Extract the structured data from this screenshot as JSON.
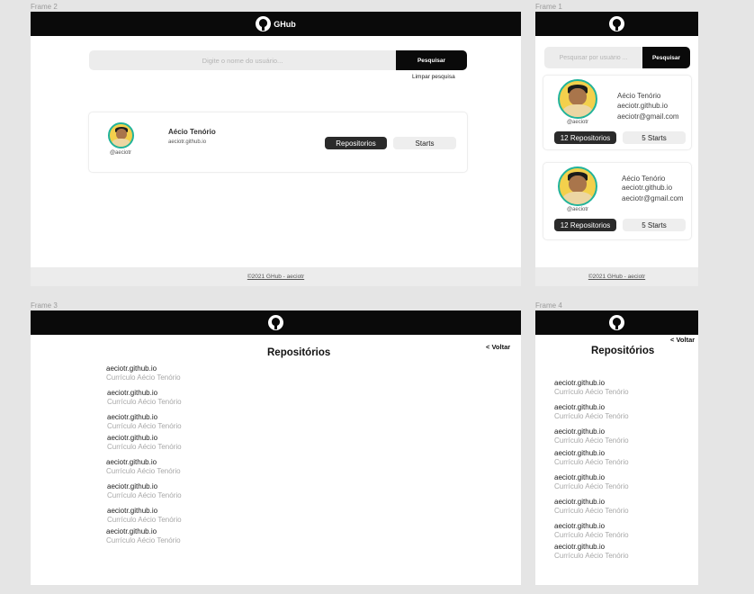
{
  "frames": {
    "frame2_label": "Frame 2",
    "frame1_label": "Frame 1",
    "frame3_label": "Frame 3",
    "frame4_label": "Frame 4"
  },
  "brand": "GHub",
  "footer": "©2021 GHub - aeciotr",
  "desktop_search": {
    "placeholder": "Digite o nome do usuário...",
    "button": "Pesquisar",
    "clear": "Limpar pesquisa"
  },
  "mobile_search": {
    "placeholder": "Pesquisar por usuário ...",
    "button": "Pesquisar"
  },
  "desktop_card": {
    "handle": "@aeciotr",
    "name": "Aécio Tenório",
    "link": "aeciotr.github.io",
    "repos_button": "Repositorios",
    "stars_button": "Starts"
  },
  "mobile_cards": [
    {
      "handle": "@aeciotr",
      "name": "Aécio Tenório",
      "link": "aeciotr.github.io",
      "email": "aeciotr@gmail.com",
      "repos_button": "12 Repositorios",
      "stars_button": "5 Starts"
    },
    {
      "handle": "@aeciotr",
      "name": "Aécio Tenório",
      "link": "aeciotr.github.io",
      "email": "aeciotr@gmail.com",
      "repos_button": "12 Repositorios",
      "stars_button": "5 Starts"
    }
  ],
  "repos_page": {
    "title": "Repositórios",
    "back": "< Voltar",
    "items": [
      {
        "name": "aeciotr.github.io",
        "desc": "Currículo Aécio Tenório"
      },
      {
        "name": "aeciotr.github.io",
        "desc": "Currículo Aécio Tenório"
      },
      {
        "name": "aeciotr.github.io",
        "desc": "Currículo Aécio Tenório"
      },
      {
        "name": "aeciotr.github.io",
        "desc": "Currículo Aécio Tenório"
      },
      {
        "name": "aeciotr.github.io",
        "desc": "Currículo Aécio Tenório"
      },
      {
        "name": "aeciotr.github.io",
        "desc": "Currículo Aécio Tenório"
      },
      {
        "name": "aeciotr.github.io",
        "desc": "Currículo Aécio Tenório"
      },
      {
        "name": "aeciotr.github.io",
        "desc": "Currículo Aécio Tenório"
      }
    ]
  },
  "colors": {
    "header": "#0a0a0a",
    "accent_ring": "#21b39b",
    "button_dark": "#2a2a2a",
    "canvas": "#e5e5e5"
  }
}
